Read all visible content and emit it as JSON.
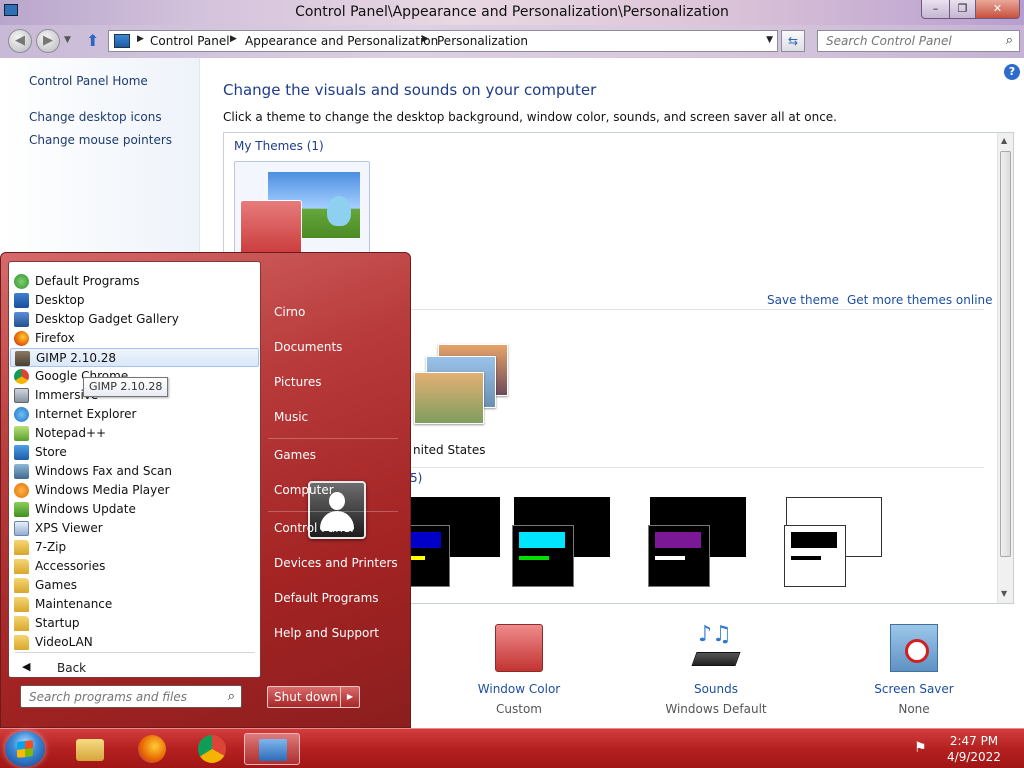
{
  "window": {
    "title": "Control Panel\\Appearance and Personalization\\Personalization",
    "minimize": "–",
    "maximize": "❐",
    "close": "✕"
  },
  "address": {
    "crumbs": [
      "Control Panel",
      "Appearance and Personalization",
      "Personalization"
    ],
    "search_placeholder": "Search Control Panel"
  },
  "sidebar": {
    "items": [
      {
        "label": "Control Panel Home"
      },
      {
        "label": "Change desktop icons"
      },
      {
        "label": "Change mouse pointers"
      }
    ]
  },
  "main": {
    "title": "Change the visuals and sounds on your computer",
    "description": "Click a theme to change the desktop background, window color, sounds, and screen saver all at once.",
    "my_themes_label": "My Themes (1)",
    "save_theme": "Save theme",
    "get_more": "Get more themes online",
    "us_theme_label": "nited States",
    "basic_label_fragment": "5)",
    "bottom": [
      {
        "label": "Window Color",
        "sub": "Custom"
      },
      {
        "label": "Sounds",
        "sub": "Windows Default"
      },
      {
        "label": "Screen Saver",
        "sub": "None"
      }
    ]
  },
  "start_menu": {
    "programs": [
      {
        "label": "Default Programs",
        "icon": "default-programs-icon"
      },
      {
        "label": "Desktop",
        "icon": "desktop-icon"
      },
      {
        "label": "Desktop Gadget Gallery",
        "icon": "gadget-icon"
      },
      {
        "label": "Firefox",
        "icon": "firefox-icon"
      },
      {
        "label": "GIMP 2.10.28",
        "icon": "gimp-icon"
      },
      {
        "label": "Google Chrome",
        "icon": "chrome-icon"
      },
      {
        "label": "Immersive",
        "icon": "immersive-icon"
      },
      {
        "label": "Internet Explorer",
        "icon": "ie-icon"
      },
      {
        "label": "Notepad++",
        "icon": "notepadpp-icon"
      },
      {
        "label": "Store",
        "icon": "store-icon"
      },
      {
        "label": "Windows Fax and Scan",
        "icon": "fax-icon"
      },
      {
        "label": "Windows Media Player",
        "icon": "media-player-icon"
      },
      {
        "label": "Windows Update",
        "icon": "windows-update-icon"
      },
      {
        "label": "XPS Viewer",
        "icon": "xps-icon"
      },
      {
        "label": "7-Zip",
        "icon": "folder-icon"
      },
      {
        "label": "Accessories",
        "icon": "folder-icon"
      },
      {
        "label": "Games",
        "icon": "folder-icon"
      },
      {
        "label": "Maintenance",
        "icon": "folder-icon"
      },
      {
        "label": "Startup",
        "icon": "folder-icon"
      },
      {
        "label": "VideoLAN",
        "icon": "folder-icon"
      }
    ],
    "tooltip": "GIMP 2.10.28",
    "back": "Back",
    "search_placeholder": "Search programs and files",
    "places": [
      {
        "label": "Cirno"
      },
      {
        "label": "Documents"
      },
      {
        "label": "Pictures"
      },
      {
        "label": "Music"
      },
      {
        "label": "Games"
      },
      {
        "label": "Computer"
      },
      {
        "label": "Control Panel"
      },
      {
        "label": "Devices and Printers"
      },
      {
        "label": "Default Programs"
      },
      {
        "label": "Help and Support"
      }
    ],
    "shutdown": "Shut down"
  },
  "taskbar": {
    "time": "2:47 PM",
    "date": "4/9/2022"
  },
  "colors": {
    "taskbar": "#b52121",
    "link": "#1e4fa0",
    "heading": "#1e3c8c"
  }
}
